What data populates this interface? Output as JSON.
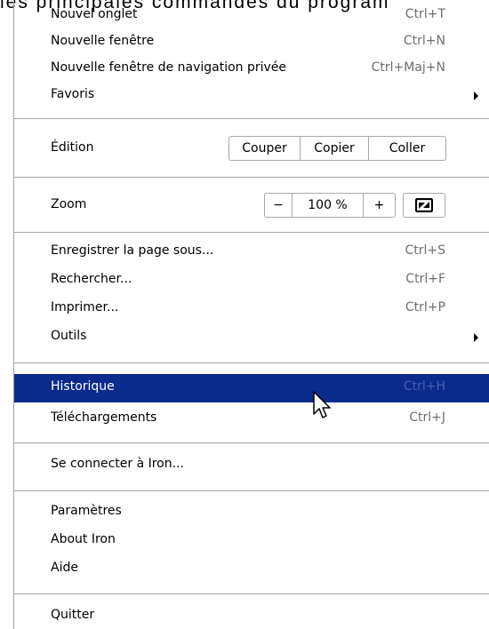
{
  "header_cut_text": "les principales commandes du program",
  "menu": {
    "new_tab": {
      "label": "Nouvel onglet",
      "shortcut": "Ctrl+T"
    },
    "new_window": {
      "label": "Nouvelle fenêtre",
      "shortcut": "Ctrl+N"
    },
    "new_private": {
      "label": "Nouvelle fenêtre de navigation privée",
      "shortcut": "Ctrl+Maj+N"
    },
    "bookmarks": {
      "label": "Favoris"
    },
    "edit": {
      "label": "Édition",
      "cut": "Couper",
      "copy": "Copier",
      "paste": "Coller"
    },
    "zoom": {
      "label": "Zoom",
      "minus": "−",
      "value": "100 %",
      "plus": "+"
    },
    "save_page": {
      "label": "Enregistrer la page sous...",
      "shortcut": "Ctrl+S"
    },
    "find": {
      "label": "Rechercher...",
      "shortcut": "Ctrl+F"
    },
    "print": {
      "label": "Imprimer...",
      "shortcut": "Ctrl+P"
    },
    "tools": {
      "label": "Outils"
    },
    "history": {
      "label": "Historique",
      "shortcut": "Ctrl+H"
    },
    "downloads": {
      "label": "Téléchargements",
      "shortcut": "Ctrl+J"
    },
    "sign_in": {
      "label": "Se connecter à Iron..."
    },
    "settings": {
      "label": "Paramètres"
    },
    "about": {
      "label": "About Iron"
    },
    "help": {
      "label": "Aide"
    },
    "quit": {
      "label": "Quitter"
    }
  },
  "colors": {
    "selected_bg": "#0a2a8c",
    "selected_text": "#ffffff",
    "shortcut_text": "#6e6e6e"
  },
  "icons": {
    "submenu_arrow": "chevron-right-icon",
    "fullscreen": "fullscreen-icon",
    "cursor": "mouse-pointer-icon"
  }
}
